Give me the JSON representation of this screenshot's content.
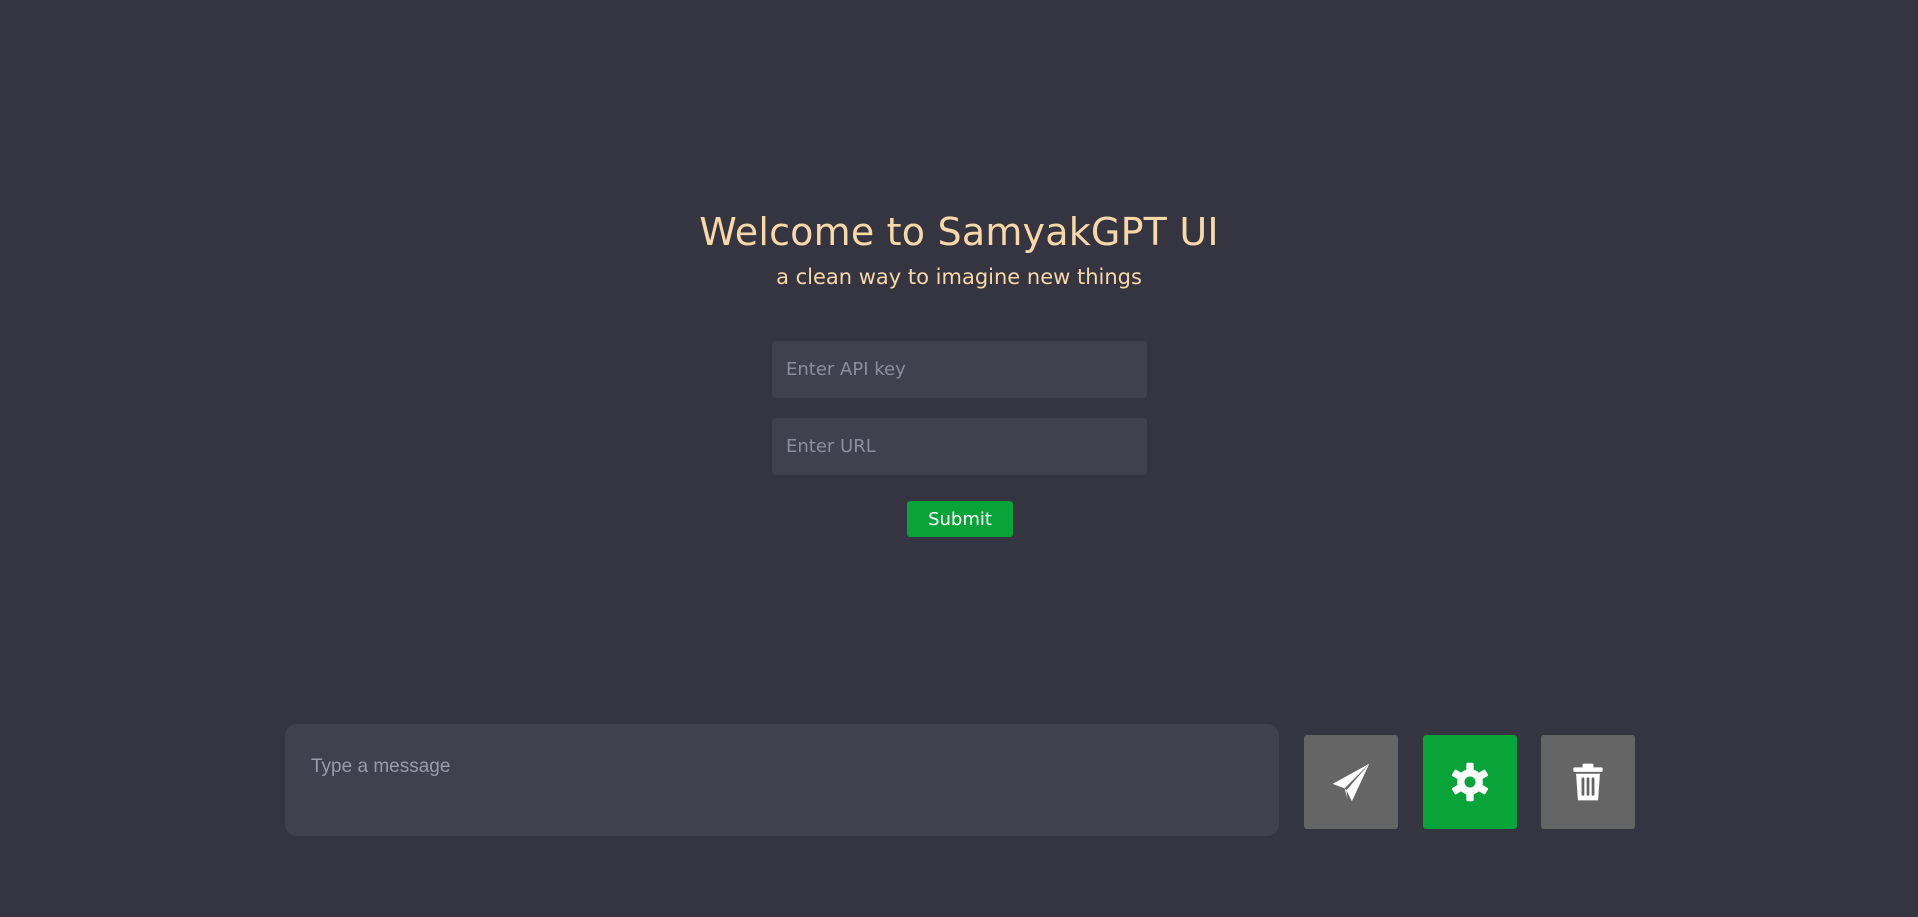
{
  "header": {
    "title": "Welcome to SamyakGPT UI",
    "subtitle": "a clean way to imagine new things"
  },
  "config_form": {
    "api_key_placeholder": "Enter API key",
    "url_placeholder": "Enter URL",
    "submit_label": "Submit"
  },
  "composer": {
    "placeholder": "Type a message"
  },
  "actions": [
    {
      "name": "send",
      "icon": "paper-plane-icon",
      "color": "#656565"
    },
    {
      "name": "settings",
      "icon": "gear-icon",
      "color": "#08a43a"
    },
    {
      "name": "delete",
      "icon": "trash-icon",
      "color": "#656565"
    }
  ],
  "theme": {
    "background": "#353542",
    "accent": "#08a43a",
    "title_color": "#f8d8a6"
  }
}
